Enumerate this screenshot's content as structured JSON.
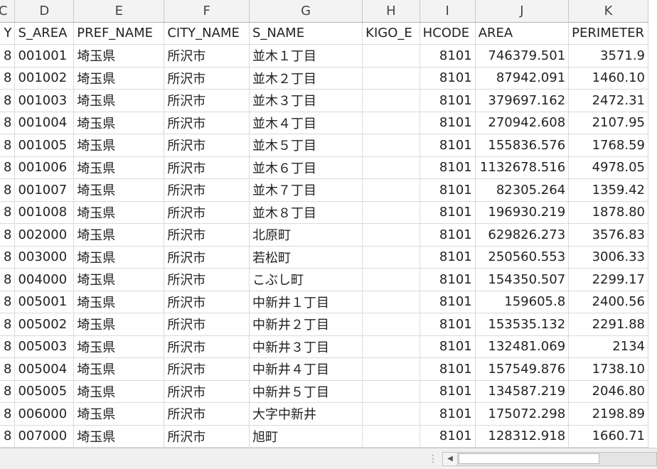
{
  "columns": [
    {
      "letter": "C",
      "header": "Y"
    },
    {
      "letter": "D",
      "header": "S_AREA"
    },
    {
      "letter": "E",
      "header": "PREF_NAME"
    },
    {
      "letter": "F",
      "header": "CITY_NAME"
    },
    {
      "letter": "G",
      "header": "S_NAME"
    },
    {
      "letter": "H",
      "header": "KIGO_E"
    },
    {
      "letter": "I",
      "header": "HCODE"
    },
    {
      "letter": "J",
      "header": "AREA"
    },
    {
      "letter": "K",
      "header": "PERIMETER"
    }
  ],
  "rows": [
    {
      "c": "8",
      "s_area": "001001",
      "pref": "埼玉県",
      "city": "所沢市",
      "s_name": "並木１丁目",
      "kigo": "",
      "hcode": "8101",
      "area": "746379.501",
      "perimeter": "3571.9"
    },
    {
      "c": "8",
      "s_area": "001002",
      "pref": "埼玉県",
      "city": "所沢市",
      "s_name": "並木２丁目",
      "kigo": "",
      "hcode": "8101",
      "area": "87942.091",
      "perimeter": "1460.10"
    },
    {
      "c": "8",
      "s_area": "001003",
      "pref": "埼玉県",
      "city": "所沢市",
      "s_name": "並木３丁目",
      "kigo": "",
      "hcode": "8101",
      "area": "379697.162",
      "perimeter": "2472.31"
    },
    {
      "c": "8",
      "s_area": "001004",
      "pref": "埼玉県",
      "city": "所沢市",
      "s_name": "並木４丁目",
      "kigo": "",
      "hcode": "8101",
      "area": "270942.608",
      "perimeter": "2107.95"
    },
    {
      "c": "8",
      "s_area": "001005",
      "pref": "埼玉県",
      "city": "所沢市",
      "s_name": "並木５丁目",
      "kigo": "",
      "hcode": "8101",
      "area": "155836.576",
      "perimeter": "1768.59"
    },
    {
      "c": "8",
      "s_area": "001006",
      "pref": "埼玉県",
      "city": "所沢市",
      "s_name": "並木６丁目",
      "kigo": "",
      "hcode": "8101",
      "area": "1132678.516",
      "perimeter": "4978.05"
    },
    {
      "c": "8",
      "s_area": "001007",
      "pref": "埼玉県",
      "city": "所沢市",
      "s_name": "並木７丁目",
      "kigo": "",
      "hcode": "8101",
      "area": "82305.264",
      "perimeter": "1359.42"
    },
    {
      "c": "8",
      "s_area": "001008",
      "pref": "埼玉県",
      "city": "所沢市",
      "s_name": "並木８丁目",
      "kigo": "",
      "hcode": "8101",
      "area": "196930.219",
      "perimeter": "1878.80"
    },
    {
      "c": "8",
      "s_area": "002000",
      "pref": "埼玉県",
      "city": "所沢市",
      "s_name": "北原町",
      "kigo": "",
      "hcode": "8101",
      "area": "629826.273",
      "perimeter": "3576.83"
    },
    {
      "c": "8",
      "s_area": "003000",
      "pref": "埼玉県",
      "city": "所沢市",
      "s_name": "若松町",
      "kigo": "",
      "hcode": "8101",
      "area": "250560.553",
      "perimeter": "3006.33"
    },
    {
      "c": "8",
      "s_area": "004000",
      "pref": "埼玉県",
      "city": "所沢市",
      "s_name": "こぶし町",
      "kigo": "",
      "hcode": "8101",
      "area": "154350.507",
      "perimeter": "2299.17"
    },
    {
      "c": "8",
      "s_area": "005001",
      "pref": "埼玉県",
      "city": "所沢市",
      "s_name": "中新井１丁目",
      "kigo": "",
      "hcode": "8101",
      "area": "159605.8",
      "perimeter": "2400.56"
    },
    {
      "c": "8",
      "s_area": "005002",
      "pref": "埼玉県",
      "city": "所沢市",
      "s_name": "中新井２丁目",
      "kigo": "",
      "hcode": "8101",
      "area": "153535.132",
      "perimeter": "2291.88"
    },
    {
      "c": "8",
      "s_area": "005003",
      "pref": "埼玉県",
      "city": "所沢市",
      "s_name": "中新井３丁目",
      "kigo": "",
      "hcode": "8101",
      "area": "132481.069",
      "perimeter": "2134"
    },
    {
      "c": "8",
      "s_area": "005004",
      "pref": "埼玉県",
      "city": "所沢市",
      "s_name": "中新井４丁目",
      "kigo": "",
      "hcode": "8101",
      "area": "157549.876",
      "perimeter": "1738.10"
    },
    {
      "c": "8",
      "s_area": "005005",
      "pref": "埼玉県",
      "city": "所沢市",
      "s_name": "中新井５丁目",
      "kigo": "",
      "hcode": "8101",
      "area": "134587.219",
      "perimeter": "2046.80"
    },
    {
      "c": "8",
      "s_area": "006000",
      "pref": "埼玉県",
      "city": "所沢市",
      "s_name": "大字中新井",
      "kigo": "",
      "hcode": "8101",
      "area": "175072.298",
      "perimeter": "2198.89"
    },
    {
      "c": "8",
      "s_area": "007000",
      "pref": "埼玉県",
      "city": "所沢市",
      "s_name": "旭町",
      "kigo": "",
      "hcode": "8101",
      "area": "128312.918",
      "perimeter": "1660.71"
    }
  ],
  "scrollbar": {
    "left_arrow": "◀",
    "grip": "⋮"
  }
}
